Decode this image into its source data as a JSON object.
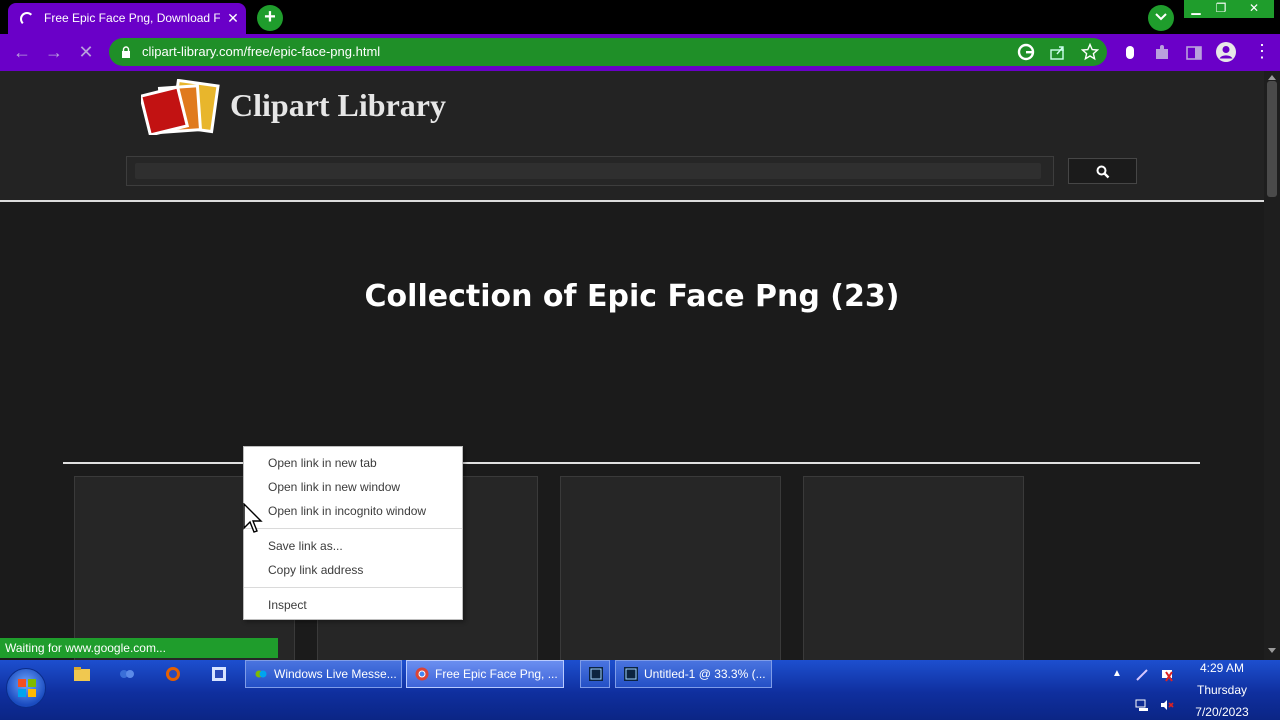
{
  "browser": {
    "tab_title": "Free Epic Face Png, Download Free Epic Face Png",
    "url": "clipart-library.com/free/epic-face-png.html"
  },
  "site": {
    "logo_text": "Clipart Library",
    "search_placeholder": ""
  },
  "main": {
    "title": "Collection of Epic Face Png (23)"
  },
  "status": "Waiting for www.google.com...",
  "context_menu": {
    "items": [
      "Open link in new tab",
      "Open link in new window",
      "Open link in incognito window",
      "Save link as...",
      "Copy link address",
      "Inspect"
    ]
  },
  "taskbar": {
    "tasks": [
      "Windows Live Messe...",
      "Free Epic Face Png, ...",
      "Untitled-1 @ 33.3% (..."
    ],
    "clock": {
      "time": "4:29 AM",
      "day": "Thursday",
      "date": "7/20/2023"
    }
  },
  "colors": {
    "tab_accent": "#6a00c8",
    "omnibox": "#1f8f28",
    "taskbar": "#1d4fcf"
  }
}
